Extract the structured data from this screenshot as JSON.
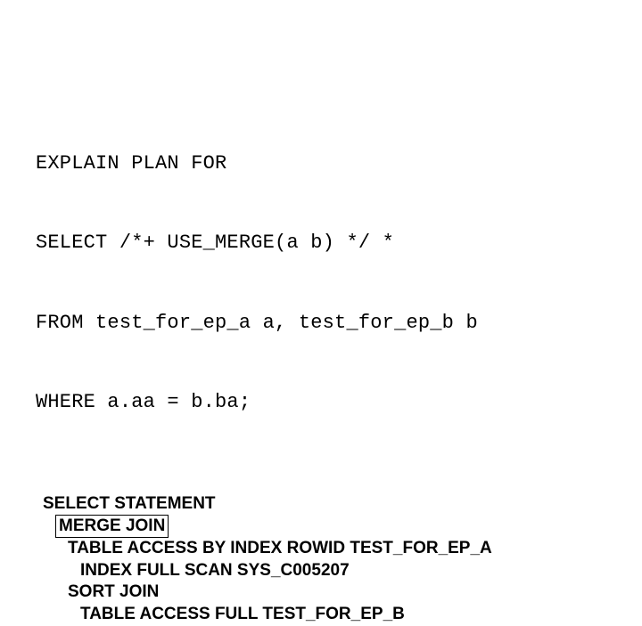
{
  "sql": {
    "line1": "EXPLAIN PLAN FOR",
    "line2": "SELECT /*+ USE_MERGE(a b) */ *",
    "line3": "FROM test_for_ep_a a, test_for_ep_b b",
    "line4": "WHERE a.aa = b.ba;"
  },
  "plan": {
    "row1": "SELECT STATEMENT",
    "row2": "MERGE JOIN",
    "row3": "TABLE ACCESS BY INDEX ROWID TEST_FOR_EP_A",
    "row4": "INDEX FULL SCAN SYS_C005207",
    "row5": "SORT JOIN",
    "row6": "TABLE ACCESS FULL TEST_FOR_EP_B"
  }
}
